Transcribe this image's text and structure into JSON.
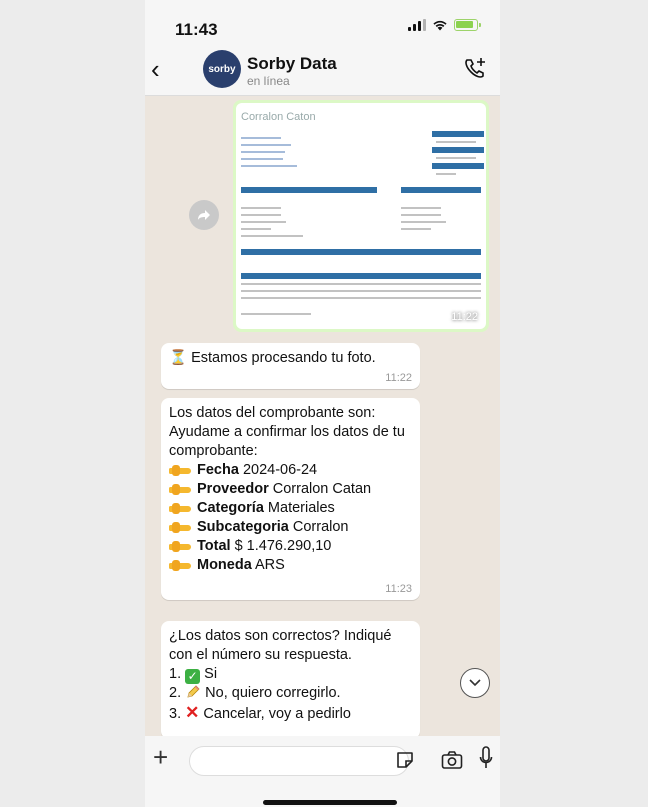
{
  "status_bar": {
    "time": "11:43"
  },
  "header": {
    "avatar_text": "sorby",
    "contact_name": "Sorby Data",
    "contact_status": "en línea"
  },
  "image_message": {
    "doc_title": "Corralon Caton",
    "time": "11:22"
  },
  "messages": [
    {
      "text": "Estamos procesando tu foto.",
      "time": "11:22"
    },
    {
      "intro": "Los datos del comprobante son: Ayudame a confirmar los datos de tu comprobante:",
      "fields": [
        {
          "label": "Fecha",
          "value": "2024-06-24"
        },
        {
          "label": "Proveedor",
          "value": "Corralon Catan"
        },
        {
          "label": "Categoría",
          "value": "Materiales"
        },
        {
          "label": "Subcategoria",
          "value": "Corralon"
        },
        {
          "label": "Total",
          "value": "$ 1.476.290,10"
        },
        {
          "label": "Moneda",
          "value": "ARS"
        }
      ],
      "time": "11:23"
    },
    {
      "question": "¿Los datos son correctos? Indiqué con el número su respuesta.",
      "options": [
        {
          "num": "1.",
          "text": "Si"
        },
        {
          "num": "2.",
          "text": "No, quiero corregirlo."
        },
        {
          "num": "3.",
          "text": "Cancelar, voy a pedirlo"
        }
      ]
    }
  ],
  "input": {
    "placeholder": ""
  },
  "colors": {
    "outgoing": "#dcf8c6",
    "background": "#ece5dd",
    "accent": "#3cb043"
  },
  "icons": [
    "back-icon",
    "call-add-icon",
    "share-icon",
    "hourglass-icon",
    "pointing-hand-icon",
    "check-mark-icon",
    "pencil-icon",
    "cross-mark-icon",
    "chevron-down-icon",
    "plus-icon",
    "sticker-icon",
    "camera-icon",
    "mic-icon"
  ]
}
